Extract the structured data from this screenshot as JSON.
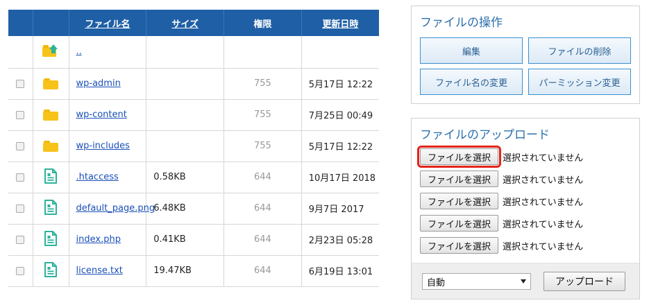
{
  "table": {
    "headers": {
      "name": "ファイル名",
      "size": "サイズ",
      "perm": "権限",
      "date": "更新日時"
    },
    "parent": {
      "name": ".."
    },
    "rows": [
      {
        "type": "folder",
        "name": "wp-admin",
        "size": "",
        "perm": "755",
        "date": "5月17日 12:22"
      },
      {
        "type": "folder",
        "name": "wp-content",
        "size": "",
        "perm": "755",
        "date": "7月25日 00:49"
      },
      {
        "type": "folder",
        "name": "wp-includes",
        "size": "",
        "perm": "755",
        "date": "5月17日 12:22"
      },
      {
        "type": "file",
        "name": ".htaccess",
        "size": "0.58KB",
        "perm": "644",
        "date": "10月17日 2018"
      },
      {
        "type": "file",
        "name": "default_page.png",
        "size": "6.48KB",
        "perm": "644",
        "date": "9月7日 2017"
      },
      {
        "type": "file",
        "name": "index.php",
        "size": "0.41KB",
        "perm": "644",
        "date": "2月23日 05:28"
      },
      {
        "type": "file",
        "name": "license.txt",
        "size": "19.47KB",
        "perm": "644",
        "date": "6月19日 13:01"
      }
    ]
  },
  "file_ops": {
    "title": "ファイルの操作",
    "edit": "編集",
    "delete": "ファイルの削除",
    "rename": "ファイル名の変更",
    "permission": "パーミッション変更"
  },
  "upload": {
    "title": "ファイルのアップロード",
    "choose_label": "ファイルを選択",
    "no_file_label": "選択されていません",
    "slots": 5,
    "mode_value": "自動",
    "upload_button": "アップロード"
  },
  "colors": {
    "header_bg": "#1f5fa6",
    "link": "#1a4fb8",
    "panel_title": "#2c6fad",
    "folder": "#f7c31a",
    "file_icon": "#2bb39a",
    "highlight": "#e2231a"
  },
  "icons": {
    "parent": "folder-up-icon",
    "folder": "folder-icon",
    "file": "document-icon"
  }
}
